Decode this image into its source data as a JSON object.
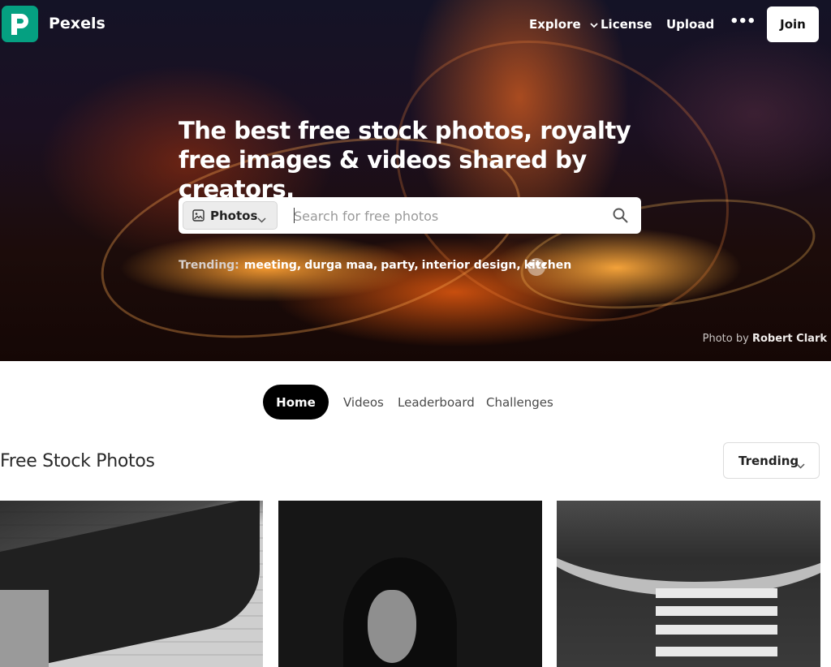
{
  "header": {
    "brand": "Pexels",
    "nav": {
      "explore": "Explore",
      "license": "License",
      "upload": "Upload",
      "more": "•••",
      "join": "Join"
    }
  },
  "hero": {
    "headline": "The best free stock photos, royalty free images & videos shared by creators.",
    "search": {
      "type_label": "Photos",
      "placeholder": "Search for free photos"
    },
    "trending": {
      "label": "Trending:",
      "tags": [
        "meeting",
        "durga maa",
        "party",
        "interior design",
        "kitchen"
      ],
      "separator": ",",
      "more": "•••"
    },
    "credit": {
      "prefix": "Photo by",
      "author": "Robert Clark"
    }
  },
  "tabs": [
    "Home",
    "Videos",
    "Leaderboard",
    "Challenges"
  ],
  "section": {
    "title": "Free Stock Photos",
    "sort_label": "Trending"
  },
  "colors": {
    "brand": "#05a081",
    "active_tab": "#000000"
  },
  "icons": {
    "logo": "pexels-logo-icon",
    "explore_chevron": "chevron-down-icon",
    "image_type": "image-icon",
    "search": "search-icon",
    "sort_chevron": "chevron-down-icon"
  }
}
